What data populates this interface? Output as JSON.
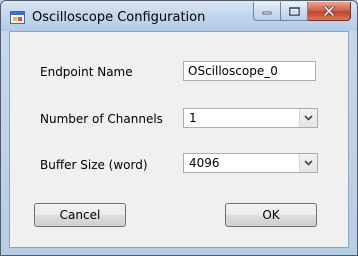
{
  "window": {
    "title": "Oscilloscope Configuration"
  },
  "icons": {
    "app": "app-icon",
    "minimize": "minimize-icon",
    "maximize": "maximize-icon",
    "close": "close-icon",
    "dropdown": "chevron-down-icon"
  },
  "form": {
    "endpoint_name": {
      "label": "Endpoint Name",
      "value": "OScilloscope_0"
    },
    "num_channels": {
      "label": "Number of Channels",
      "value": "1"
    },
    "buffer_size": {
      "label": "Buffer Size (word)",
      "value": "4096"
    }
  },
  "buttons": {
    "cancel": "Cancel",
    "ok": "OK"
  },
  "colors": {
    "close_button": "#c0432c",
    "client_bg": "#f0f0f0",
    "frame": "#b9d1ea"
  }
}
